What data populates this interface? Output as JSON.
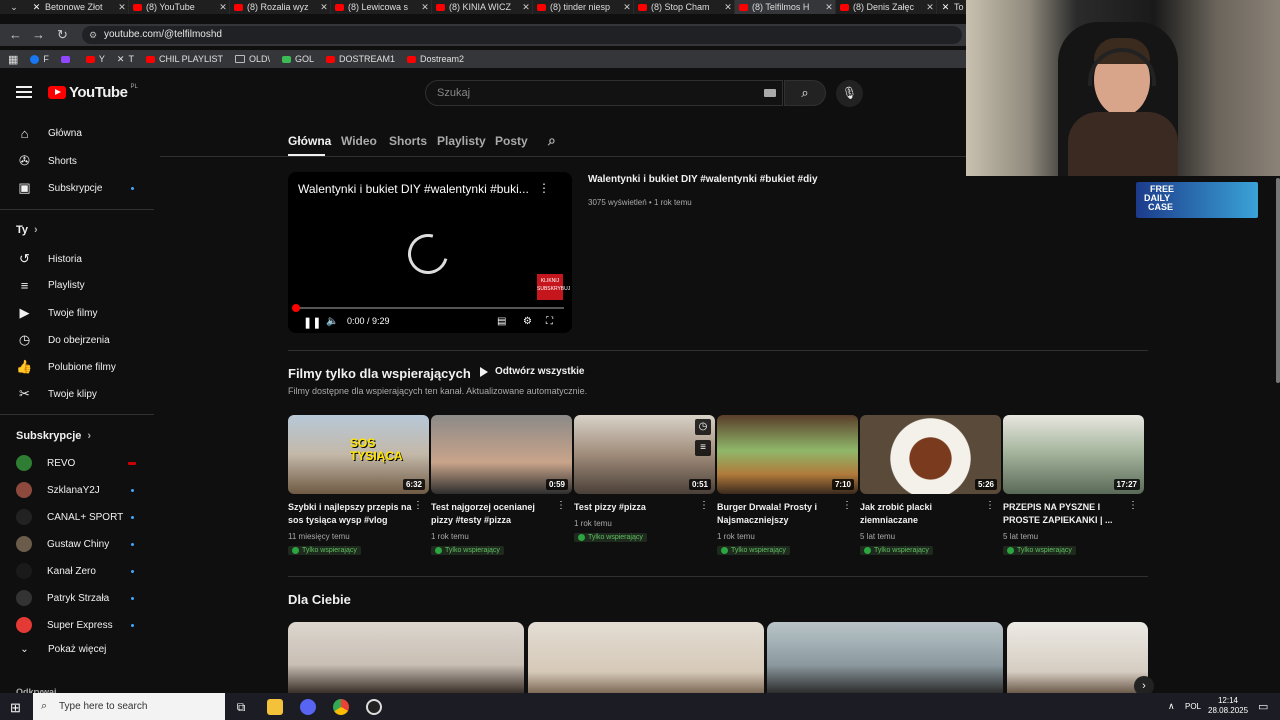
{
  "browser": {
    "tabs": [
      {
        "label": "Betonowe Złot",
        "icon": "x-logo-icon"
      },
      {
        "label": "(8) YouTube",
        "icon": "youtube-icon"
      },
      {
        "label": "(8) Rozalia wyz",
        "icon": "youtube-icon"
      },
      {
        "label": "(8) Lewicowa s",
        "icon": "youtube-icon"
      },
      {
        "label": "(8) KINIA WICZ",
        "icon": "youtube-icon"
      },
      {
        "label": "(8) tinder niesp",
        "icon": "youtube-icon"
      },
      {
        "label": "(8) Stop Cham",
        "icon": "youtube-icon"
      },
      {
        "label": "(8) Telfilmos H",
        "icon": "youtube-icon"
      },
      {
        "label": "(8) Denis Załęc",
        "icon": "youtube-icon"
      },
      {
        "label": "To",
        "icon": "x-logo-icon"
      }
    ],
    "url": "youtube.com/@telfilmoshd",
    "bookmarks": [
      "F",
      "",
      "Y",
      "T",
      "CHIL PLAYLIST",
      "OLD\\",
      "GOL",
      "DOSTREAM1",
      "Dostream2"
    ]
  },
  "header": {
    "logo_text": "YouTube",
    "region": "PL",
    "search_placeholder": "Szukaj"
  },
  "sidebar": {
    "main": [
      {
        "label": "Główna",
        "icon": "home-icon"
      },
      {
        "label": "Shorts",
        "icon": "shorts-icon"
      },
      {
        "label": "Subskrypcje",
        "icon": "subscriptions-icon"
      }
    ],
    "you_title": "Ty",
    "you": [
      {
        "label": "Historia",
        "icon": "history-icon"
      },
      {
        "label": "Playlisty",
        "icon": "playlists-icon"
      },
      {
        "label": "Twoje filmy",
        "icon": "your-videos-icon"
      },
      {
        "label": "Do obejrzenia",
        "icon": "watch-later-icon"
      },
      {
        "label": "Polubione filmy",
        "icon": "liked-icon"
      },
      {
        "label": "Twoje klipy",
        "icon": "clips-icon"
      }
    ],
    "subs_title": "Subskrypcje",
    "subs": [
      {
        "label": "REVO",
        "color": "#2e7d32"
      },
      {
        "label": "SzklanaY2J",
        "color": "#8d4a3c"
      },
      {
        "label": "CANAL+ SPORT",
        "color": "#222222"
      },
      {
        "label": "Gustaw Chiny",
        "color": "#6b5b4b"
      },
      {
        "label": "Kanał Zero",
        "color": "#1a1a1a"
      },
      {
        "label": "Patryk Strzała",
        "color": "#333333"
      },
      {
        "label": "Super Express",
        "color": "#e53935"
      },
      {
        "label": "Pokaż więcej",
        "color": ""
      }
    ],
    "explore_title": "Odkrywaj"
  },
  "channel_tabs": [
    "Główna",
    "Wideo",
    "Shorts",
    "Playlisty",
    "Posty"
  ],
  "featured": {
    "title": "Walentynki i bukiet DIY #walentynki #buki...",
    "full_title": "Walentynki i bukiet DIY #walentynki #bukiet #diy",
    "meta": "3075 wyświetleń • 1 rok temu",
    "time": "0:00 / 9:29",
    "badge": "KLIKNIJ SUBSKRYBUJ",
    "progress_fraction": 0.0
  },
  "members_section": {
    "title": "Filmy tylko dla wspierających",
    "play_all": "Odtwórz wszystkie",
    "subtitle": "Filmy dostępne dla wspierających ten kanał. Aktualizowane automatycznie.",
    "members_label": "Tylko wspierający",
    "videos": [
      {
        "title": "Szybki i najlepszy przepis na sos tysiąca wysp #vlog",
        "duration": "6:32",
        "meta": "11 miesięcy temu",
        "thumb_text": "SOS TYSIĄCA"
      },
      {
        "title": "Test najgorzej ocenianej pizzy #testy #pizza",
        "duration": "0:59",
        "meta": "1 rok temu",
        "thumb_text": ""
      },
      {
        "title": "Test pizzy #pizza",
        "duration": "0:51",
        "meta": "1 rok temu",
        "thumb_text": ""
      },
      {
        "title": "Burger Drwala! Prosty i Najsmaczniejszy",
        "duration": "7:10",
        "meta": "1 rok temu",
        "thumb_text": ""
      },
      {
        "title": "Jak zrobić placki ziemniaczane",
        "duration": "5:26",
        "meta": "5 lat temu",
        "thumb_text": ""
      },
      {
        "title": "PRZEPIS NA PYSZNE I PROSTE ZAPIEKANKI | ...",
        "duration": "17:27",
        "meta": "5 lat temu",
        "thumb_text": ""
      }
    ]
  },
  "for_you": {
    "title": "Dla Ciebie"
  },
  "ad": {
    "line1": "FREE",
    "line2": "DAILY",
    "line3": "CASE"
  },
  "taskbar": {
    "search_placeholder": "Type here to search",
    "lang": "POL",
    "time": "12:14",
    "date": "28.08.2025"
  }
}
